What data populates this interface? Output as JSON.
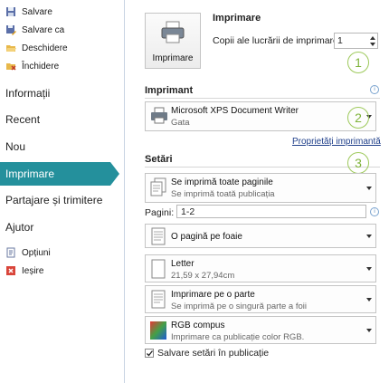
{
  "nav": {
    "save": "Salvare",
    "save_as": "Salvare ca",
    "open": "Deschidere",
    "close": "Închidere",
    "info": "Informații",
    "recent": "Recent",
    "new": "Nou",
    "print": "Imprimare",
    "share": "Partajare și trimitere",
    "help": "Ajutor",
    "options": "Opțiuni",
    "exit": "Ieșire"
  },
  "print": {
    "title": "Imprimare",
    "button_label": "Imprimare",
    "copies_label": "Copii ale lucrării de imprimare:",
    "copies_value": "1"
  },
  "printer": {
    "title": "Imprimant",
    "name": "Microsoft XPS Document Writer",
    "status": "Gata",
    "properties_link": "Proprietăți imprimantă"
  },
  "settings": {
    "title": "Setări",
    "pages_option": {
      "main": "Se imprimă toate paginile",
      "sub": "Se imprimă toată publicația"
    },
    "pages_label": "Pagini:",
    "pages_value": "1-2",
    "per_sheet": {
      "main": "O pagină pe foaie"
    },
    "paper": {
      "main": "Letter",
      "sub": "21,59 x 27,94cm"
    },
    "sides": {
      "main": "Imprimare pe o parte",
      "sub": "Se imprimă pe o singură parte a foii"
    },
    "color": {
      "main": "RGB compus",
      "sub": "Imprimare ca publicație color RGB."
    },
    "save_checkbox": "Salvare setări în publicație"
  },
  "callouts": [
    "1",
    "2",
    "3"
  ],
  "colors": {
    "accent": "#24909c",
    "callout": "#9dc95b"
  }
}
